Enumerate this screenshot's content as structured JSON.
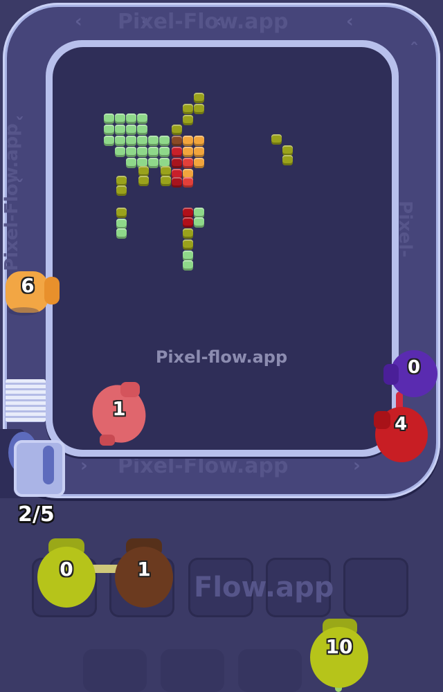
{
  "watermark": "Pixel-flow.app",
  "track_watermark_top": "Pixel-Flow.app",
  "track_watermark_bottom": "Pixel-Flow.app",
  "track_watermark_left": "Pixel-Flow.app",
  "track_watermark_right": "Pixel-Flow.app",
  "slot_watermark": "Flow.app",
  "pig_capacity_counter": "2/5",
  "pigs": {
    "orange_left": {
      "ammo": "6",
      "color": "#f2a644"
    },
    "pink_center": {
      "ammo": "1",
      "color": "#e0666d"
    },
    "purple_right": {
      "ammo": "0",
      "color": "#5a2bb0"
    },
    "red_right": {
      "ammo": "4",
      "color": "#c81e24"
    },
    "slot_yellow": {
      "ammo": "0",
      "color": "#b6c41a"
    },
    "slot_brown": {
      "ammo": "1",
      "color": "#6b3a1f"
    },
    "queue_yellow": {
      "ammo": "10",
      "color": "#b6c41a"
    }
  },
  "colors": {
    "background": "#3b3a66",
    "board": "#2f2e58",
    "track": "#aab4e6"
  }
}
